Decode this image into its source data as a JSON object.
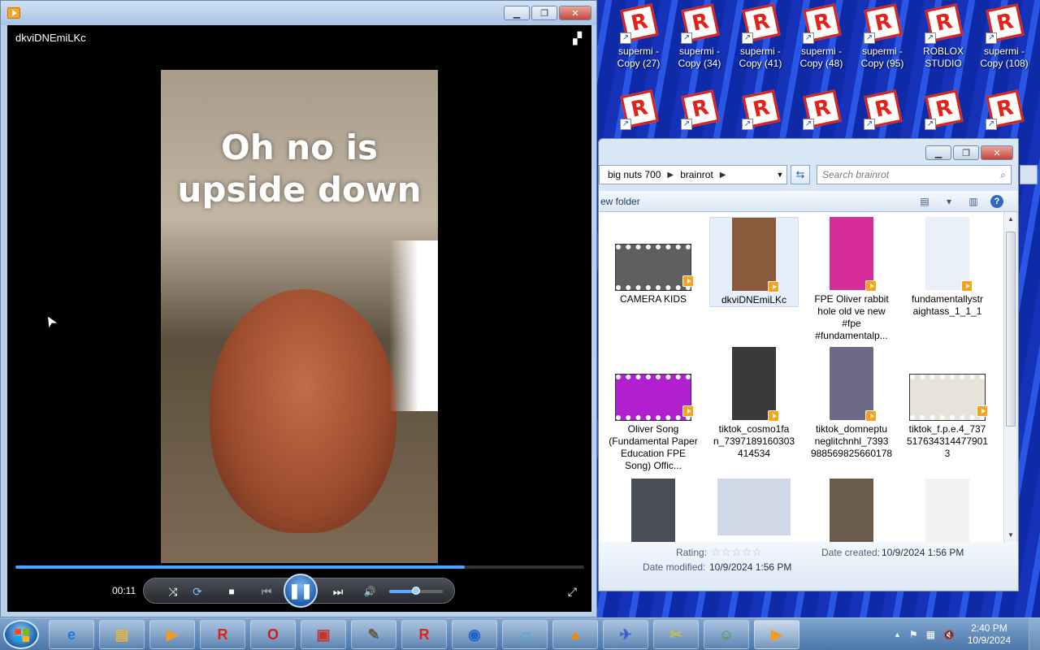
{
  "desktop": {
    "icons_row1": [
      {
        "label": "supermi - Copy (27)",
        "glyph": "R"
      },
      {
        "label": "supermi - Copy (34)",
        "glyph": "R"
      },
      {
        "label": "supermi - Copy (41)",
        "glyph": "R"
      },
      {
        "label": "supermi - Copy (48)",
        "glyph": "R"
      },
      {
        "label": "supermi - Copy (95)",
        "glyph": "R"
      },
      {
        "label": "ROBLOX STUDIO",
        "glyph": "R"
      },
      {
        "label": "supermi - Copy (108)",
        "glyph": "R"
      }
    ],
    "icons_row2_glyph": "R"
  },
  "player": {
    "video_title": "dkviDNEmiLKc",
    "caption_text": "Oh no is\nupside down",
    "time": "00:11",
    "progress": 0.79,
    "volume": 0.5,
    "play_glyph": "❚❚",
    "layout_glyph": "▞",
    "fullscreen_glyph": "⤢",
    "controls": {
      "shuffle": "⤨",
      "repeat": "⟳",
      "stop": "■",
      "prev": "⏮",
      "next": "⏭",
      "mute": "🔊"
    }
  },
  "explorer": {
    "breadcrumb": [
      "big nuts 700",
      "brainrot"
    ],
    "search_placeholder": "Search brainrot",
    "toolbar_left": "ew folder",
    "files": [
      {
        "name": "CAMERA KIDS",
        "kind": "film",
        "color": "#5f5f5f"
      },
      {
        "name": "dkviDNEmiLKc",
        "kind": "portrait",
        "color": "#8a5a3c",
        "selected": true
      },
      {
        "name": "FPE Oliver rabbit hole old ve new #fpe #fundamentalp...",
        "kind": "portrait",
        "color": "#d62c9a"
      },
      {
        "name": "fundamentallystr aightass_1_1_1",
        "kind": "portrait",
        "color": "#eaf0f7"
      },
      {
        "name": "Oliver Song (Fundamental Paper Education FPE Song) Offic...",
        "kind": "film",
        "color": "#b01fd0"
      },
      {
        "name": "tiktok_cosmo1fa n_7397189160303 414534",
        "kind": "portrait",
        "color": "#3a3a3a"
      },
      {
        "name": "tiktok_domneptu neglitchnhl_7393 988569825660178",
        "kind": "portrait",
        "color": "#6c6a86"
      },
      {
        "name": "tiktok_f.p.e.4_737 517634314477901 3",
        "kind": "film",
        "color": "#e8e3d8"
      },
      {
        "name": "",
        "kind": "portrait",
        "color": "#4a4f57"
      },
      {
        "name": "",
        "kind": "square",
        "color": "#cfd8e6"
      },
      {
        "name": "",
        "kind": "portrait",
        "color": "#6b5b4a"
      },
      {
        "name": "",
        "kind": "portrait",
        "color": "#f2f2f2"
      }
    ],
    "details": {
      "rating_label": "Rating:",
      "date_modified_label": "Date modified:",
      "date_modified": "10/9/2024 1:56 PM",
      "date_created_label": "Date created:",
      "date_created": "10/9/2024 1:56 PM",
      "stars": "☆☆☆☆☆"
    }
  },
  "taskbar": {
    "items": [
      {
        "name": "ie",
        "glyph": "e",
        "color": "#1d7ad6"
      },
      {
        "name": "explorer",
        "glyph": "▤",
        "color": "#e3b53c"
      },
      {
        "name": "media-player",
        "glyph": "▶",
        "color": "#f29b1f"
      },
      {
        "name": "roblox",
        "glyph": "R",
        "color": "#e2231a"
      },
      {
        "name": "opera",
        "glyph": "O",
        "color": "#d11c1c"
      },
      {
        "name": "toolbox",
        "glyph": "▣",
        "color": "#c8322c"
      },
      {
        "name": "gimp",
        "glyph": "✎",
        "color": "#6b5a46"
      },
      {
        "name": "roblox-studio",
        "glyph": "R",
        "color": "#e2231a"
      },
      {
        "name": "browser",
        "glyph": "◉",
        "color": "#1e63c9"
      },
      {
        "name": "notes",
        "glyph": "▱",
        "color": "#58a7c7"
      },
      {
        "name": "vlc",
        "glyph": "▲",
        "color": "#f08a00"
      },
      {
        "name": "jet",
        "glyph": "✈",
        "color": "#3c5bd6"
      },
      {
        "name": "tool",
        "glyph": "✂",
        "color": "#c9c23a"
      },
      {
        "name": "people",
        "glyph": "☺",
        "color": "#3d9b3d"
      },
      {
        "name": "media-player-running",
        "glyph": "▶",
        "color": "#f29b1f"
      }
    ],
    "tray": {
      "time": "2:40 PM",
      "date": "10/9/2024",
      "up_glyph": "▲",
      "flag_glyph": "⚑",
      "network_glyph": "▦",
      "volume_glyph": "🔇"
    }
  },
  "colors": {
    "accent": "#4aa3ff",
    "desktop": "#1b3fc7"
  }
}
